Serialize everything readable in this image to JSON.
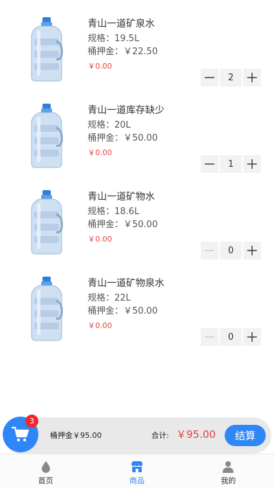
{
  "products": [
    {
      "name": "青山一道矿泉水",
      "spec": "规格：19.5L",
      "deposit": "桶押金：￥22.50",
      "price": "￥0.00",
      "quantity": "2",
      "minus_enabled": true,
      "icon": "water-bottle-icon"
    },
    {
      "name": "青山一道库存缺少",
      "spec": "规格：20L",
      "deposit": "桶押金：￥50.00",
      "price": "￥0.00",
      "quantity": "1",
      "minus_enabled": true,
      "icon": "water-bottle-icon"
    },
    {
      "name": "青山一道矿物水",
      "spec": "规格：18.6L",
      "deposit": "桶押金：￥50.00",
      "price": "￥0.00",
      "quantity": "0",
      "minus_enabled": false,
      "icon": "water-bottle-icon"
    },
    {
      "name": "青山一道矿物泉水",
      "spec": "规格：22L",
      "deposit": "桶押金：￥50.00",
      "price": "￥0.00",
      "quantity": "0",
      "minus_enabled": false,
      "icon": "water-bottle-icon"
    }
  ],
  "cart": {
    "count": "3",
    "deposit_summary": "桶押金￥95.00",
    "total_label": "合计:",
    "total_value": "￥95.00",
    "checkout_label": "结算",
    "icon": "cart-icon"
  },
  "tabbar": {
    "items": [
      {
        "label": "首页",
        "icon": "water-drop-icon",
        "active": false
      },
      {
        "label": "商品",
        "icon": "store-icon",
        "active": true
      },
      {
        "label": "我的",
        "icon": "user-icon",
        "active": false
      }
    ]
  },
  "colors": {
    "accent": "#2f86f6",
    "price": "#e64340",
    "badge": "#f0262f",
    "disabled": "#c8c8c8"
  }
}
